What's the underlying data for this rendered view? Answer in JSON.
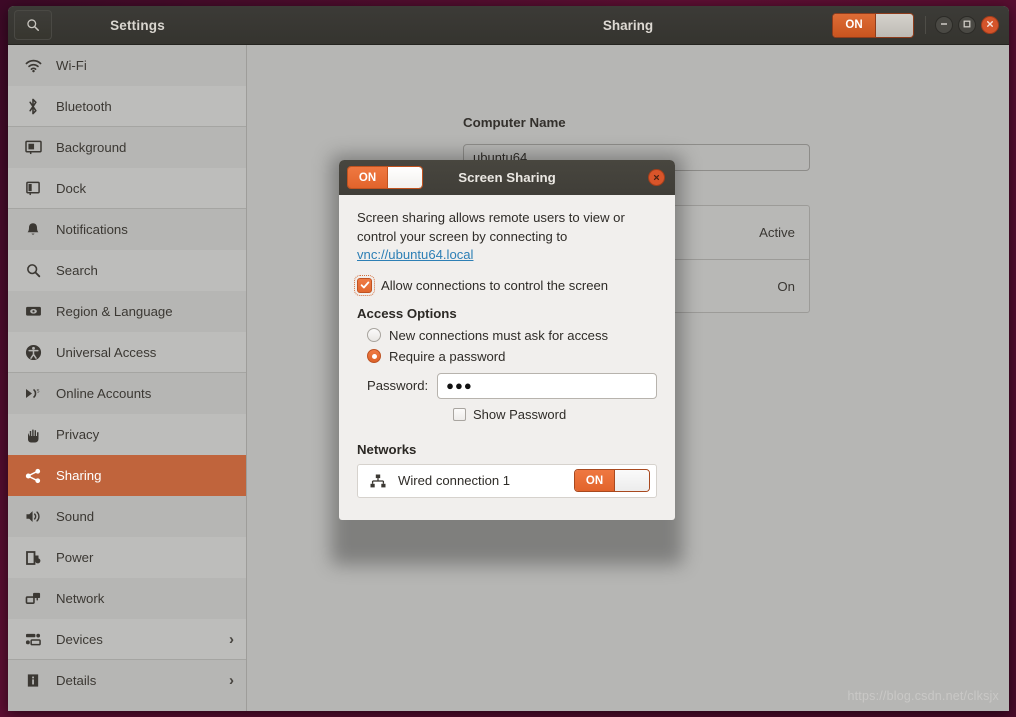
{
  "titlebar": {
    "search_icon": "search-icon",
    "settings_title": "Settings",
    "panel_title": "Sharing",
    "master_toggle_label": "ON",
    "minimize_icon": "minimize-icon",
    "maximize_icon": "maximize-icon",
    "close_icon": "close-icon"
  },
  "sidebar": {
    "items": [
      {
        "label": "Wi-Fi",
        "icon": "wifi-icon"
      },
      {
        "label": "Bluetooth",
        "icon": "bluetooth-icon"
      },
      {
        "label": "Background",
        "icon": "background-icon"
      },
      {
        "label": "Dock",
        "icon": "dock-icon"
      },
      {
        "label": "Notifications",
        "icon": "bell-icon"
      },
      {
        "label": "Search",
        "icon": "search-icon"
      },
      {
        "label": "Region & Language",
        "icon": "region-language-icon"
      },
      {
        "label": "Universal Access",
        "icon": "universal-access-icon"
      },
      {
        "label": "Online Accounts",
        "icon": "online-accounts-icon"
      },
      {
        "label": "Privacy",
        "icon": "privacy-hand-icon"
      },
      {
        "label": "Sharing",
        "icon": "sharing-icon"
      },
      {
        "label": "Sound",
        "icon": "sound-icon"
      },
      {
        "label": "Power",
        "icon": "power-icon"
      },
      {
        "label": "Network",
        "icon": "network-icon"
      },
      {
        "label": "Devices",
        "icon": "devices-icon",
        "chevron": "›"
      },
      {
        "label": "Details",
        "icon": "details-info-icon",
        "chevron": "›"
      }
    ],
    "active_index": 10
  },
  "main": {
    "computer_name_label": "Computer Name",
    "computer_name_value": "ubuntu64",
    "list_rows": [
      {
        "status": "Active"
      },
      {
        "status": "On"
      }
    ],
    "watermark": "https://blog.csdn.net/clksjx"
  },
  "dialog": {
    "toggle_label": "ON",
    "title": "Screen Sharing",
    "close_icon": "close-icon",
    "description_part1": "Screen sharing allows remote users to view or control your screen by connecting to ",
    "description_link": "vnc://ubuntu64.local",
    "allow_control_label": "Allow connections to control the screen",
    "access_options_title": "Access Options",
    "radio_ask_label": "New connections must ask for access",
    "radio_password_label": "Require a password",
    "password_label": "Password:",
    "password_value": "●●●",
    "show_password_label": "Show Password",
    "networks_title": "Networks",
    "network_name": "Wired connection 1",
    "network_toggle_label": "ON",
    "network_icon": "wired-network-icon"
  },
  "colors": {
    "accent_orange": "#e2642c",
    "sidebar_selected": "#c0643c",
    "link_blue": "#2d7fb5",
    "titlebar_dark": "#3c3b37",
    "window_bg": "#b6b6b4",
    "dialog_bg": "#f1efed",
    "desktop": "#520a2e"
  }
}
